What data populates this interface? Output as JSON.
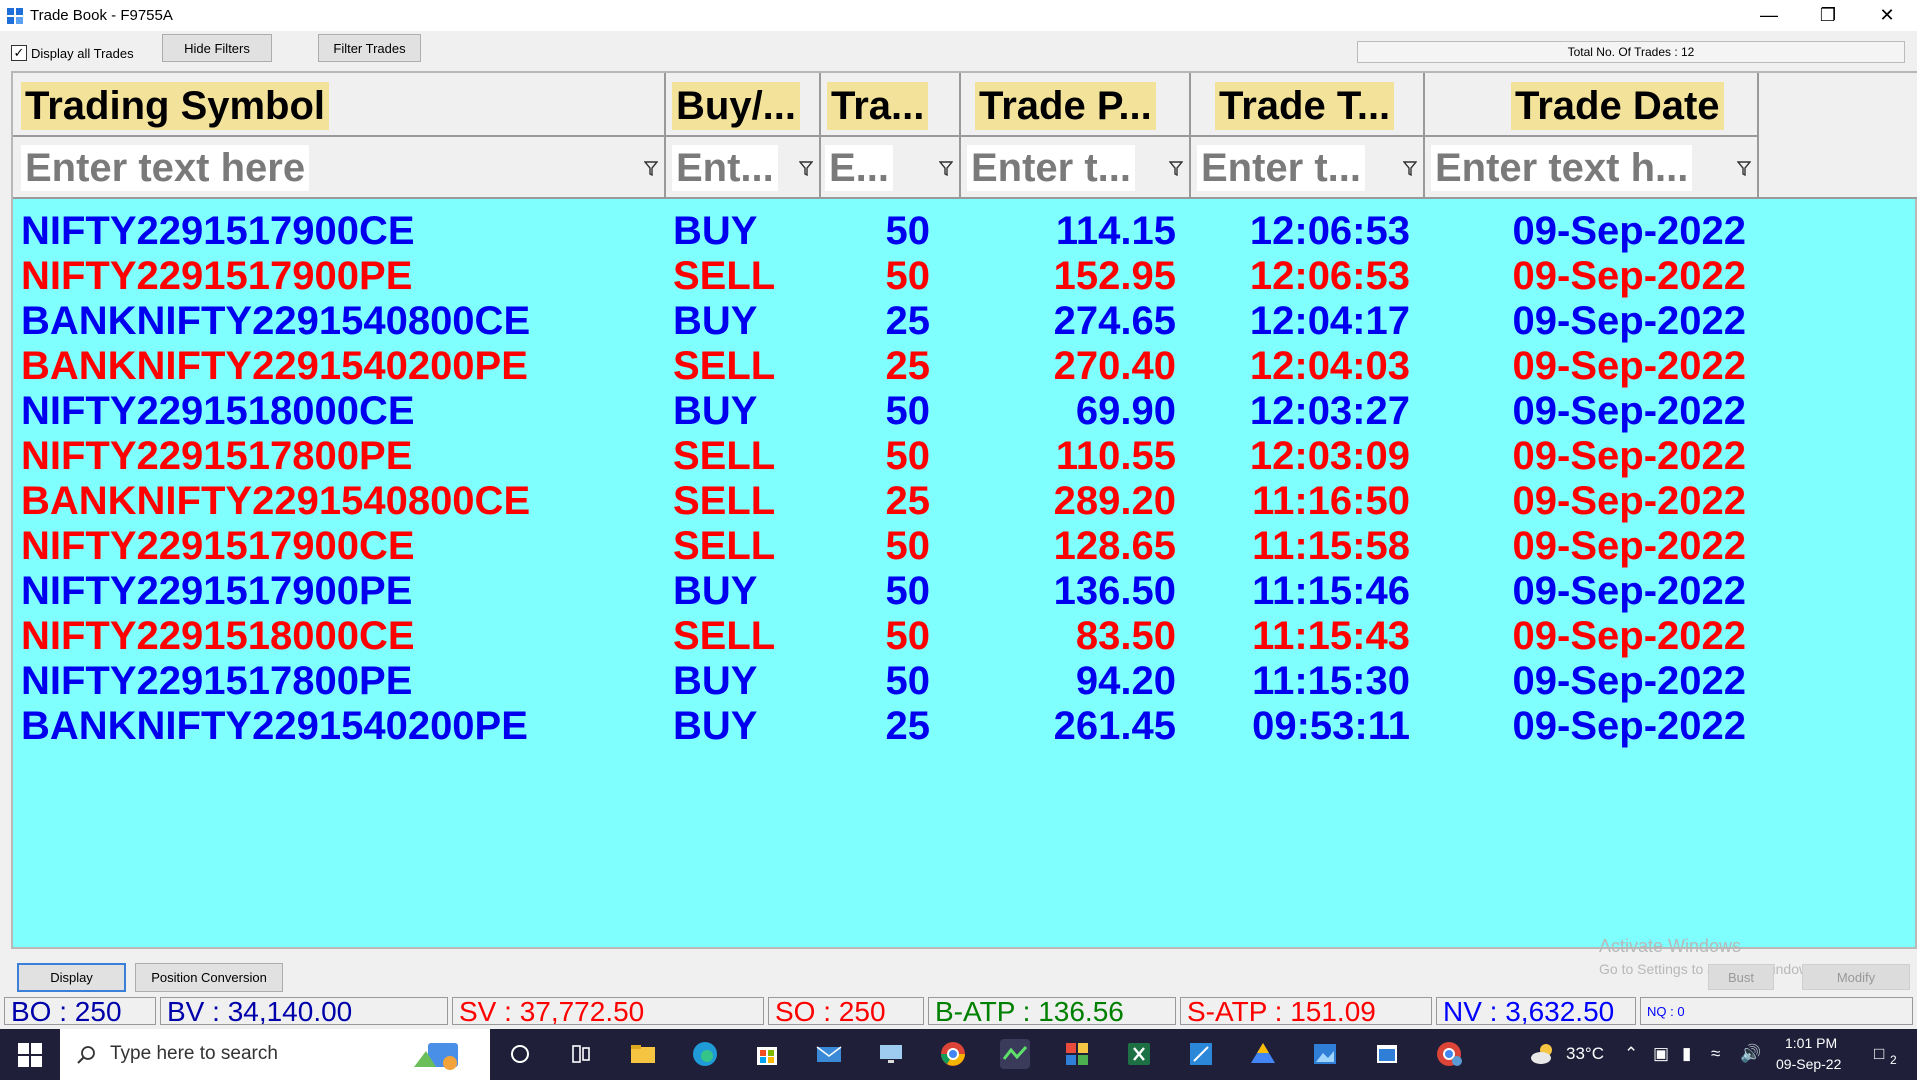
{
  "window": {
    "title": "Trade Book - F9755A"
  },
  "toolbar": {
    "display_all_label": "Display all Trades",
    "display_all_checked": true,
    "hide_filters": "Hide Filters",
    "filter_trades": "Filter Trades",
    "total_trades": "Total No. Of Trades : 12"
  },
  "columns": [
    {
      "header": "Trading Symbol",
      "filter": "Enter text here"
    },
    {
      "header": "Buy/...",
      "filter": "Ent..."
    },
    {
      "header": "Tra...",
      "filter": "E..."
    },
    {
      "header": "Trade P...",
      "filter": "Enter t..."
    },
    {
      "header": "Trade T...",
      "filter": "Enter t..."
    },
    {
      "header": "Trade Date",
      "filter": "Enter text h..."
    }
  ],
  "trades": [
    {
      "symbol": "NIFTY2291517900CE",
      "side": "BUY",
      "qty": "50",
      "price": "114.15",
      "time": "12:06:53",
      "date": "09-Sep-2022"
    },
    {
      "symbol": "NIFTY2291517900PE",
      "side": "SELL",
      "qty": "50",
      "price": "152.95",
      "time": "12:06:53",
      "date": "09-Sep-2022"
    },
    {
      "symbol": "BANKNIFTY2291540800CE",
      "side": "BUY",
      "qty": "25",
      "price": "274.65",
      "time": "12:04:17",
      "date": "09-Sep-2022"
    },
    {
      "symbol": "BANKNIFTY2291540200PE",
      "side": "SELL",
      "qty": "25",
      "price": "270.40",
      "time": "12:04:03",
      "date": "09-Sep-2022"
    },
    {
      "symbol": "NIFTY2291518000CE",
      "side": "BUY",
      "qty": "50",
      "price": "69.90",
      "time": "12:03:27",
      "date": "09-Sep-2022"
    },
    {
      "symbol": "NIFTY2291517800PE",
      "side": "SELL",
      "qty": "50",
      "price": "110.55",
      "time": "12:03:09",
      "date": "09-Sep-2022"
    },
    {
      "symbol": "BANKNIFTY2291540800CE",
      "side": "SELL",
      "qty": "25",
      "price": "289.20",
      "time": "11:16:50",
      "date": "09-Sep-2022"
    },
    {
      "symbol": "NIFTY2291517900CE",
      "side": "SELL",
      "qty": "50",
      "price": "128.65",
      "time": "11:15:58",
      "date": "09-Sep-2022"
    },
    {
      "symbol": "NIFTY2291517900PE",
      "side": "BUY",
      "qty": "50",
      "price": "136.50",
      "time": "11:15:46",
      "date": "09-Sep-2022"
    },
    {
      "symbol": "NIFTY2291518000CE",
      "side": "SELL",
      "qty": "50",
      "price": "83.50",
      "time": "11:15:43",
      "date": "09-Sep-2022"
    },
    {
      "symbol": "NIFTY2291517800PE",
      "side": "BUY",
      "qty": "50",
      "price": "94.20",
      "time": "11:15:30",
      "date": "09-Sep-2022"
    },
    {
      "symbol": "BANKNIFTY2291540200PE",
      "side": "BUY",
      "qty": "25",
      "price": "261.45",
      "time": "09:53:11",
      "date": "09-Sep-2022"
    }
  ],
  "bottom": {
    "display_btn": "Display",
    "position_conversion_btn": "Position Conversion",
    "bust_btn": "Bust",
    "modify_btn": "Modify",
    "watermark_line1": "Activate Windows",
    "watermark_line2": "Go to Settings to activate Windows."
  },
  "stats": [
    {
      "text": "BO : 250",
      "color": "#0000aa"
    },
    {
      "text": "BV : 34,140.00",
      "color": "#0000aa"
    },
    {
      "text": "SV : 37,772.50",
      "color": "#ff0000"
    },
    {
      "text": "SO : 250",
      "color": "#ff0000"
    },
    {
      "text": "B-ATP : 136.56",
      "color": "#008000"
    },
    {
      "text": "S-ATP : 151.09",
      "color": "#ff0000"
    },
    {
      "text": "NV : 3,632.50",
      "color": "#0000ff"
    },
    {
      "text": "NQ : 0",
      "color": "#0000ff"
    }
  ],
  "taskbar": {
    "search_placeholder": "Type here to search",
    "weather": "33°C",
    "time": "1:01 PM",
    "date": "09-Sep-22",
    "notification_count": "2"
  },
  "colors": {
    "grid_bg": "#80ffff",
    "buy": "#0000ee",
    "sell": "#ff0000",
    "header_label_bg": "#f3e39a"
  }
}
